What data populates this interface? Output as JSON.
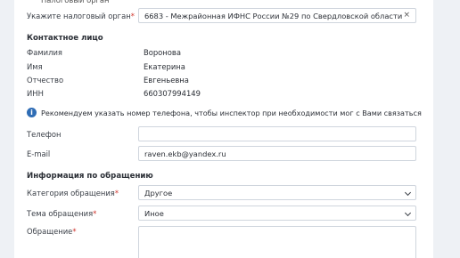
{
  "tax_office": {
    "label": "Укажите налоговый орган",
    "required_mark": "*",
    "value": "6683 - Межрайонная ИФНС России №29 по Свердловской области",
    "clear_symbol": "×"
  },
  "contact": {
    "section_title": "Контактное лицо",
    "rows": [
      {
        "label": "Фамилия",
        "value": "Воронова"
      },
      {
        "label": "Имя",
        "value": "Екатерина"
      },
      {
        "label": "Отчество",
        "value": "Евгеньевна"
      },
      {
        "label": "ИНН",
        "value": "660307994149"
      }
    ]
  },
  "notice": {
    "icon": "info-icon",
    "icon_glyph": "i",
    "text": "Рекомендуем указать номер телефона, чтобы инспектор при необходимости мог с Вами связаться"
  },
  "phone": {
    "label": "Телефон",
    "value": ""
  },
  "email": {
    "label": "E-mail",
    "value": "raven.ekb@yandex.ru"
  },
  "request": {
    "section_title": "Информация по обращению",
    "category": {
      "label": "Категория обращения",
      "required_mark": "*",
      "value": "Другое"
    },
    "topic": {
      "label": "Тема обращения",
      "required_mark": "*",
      "value": "Иное"
    },
    "message": {
      "label": "Обращение",
      "required_mark": "*",
      "value": ""
    }
  },
  "colors": {
    "accent": "#2f6db5",
    "required": "#d0342c",
    "border": "#cfd5dd"
  }
}
